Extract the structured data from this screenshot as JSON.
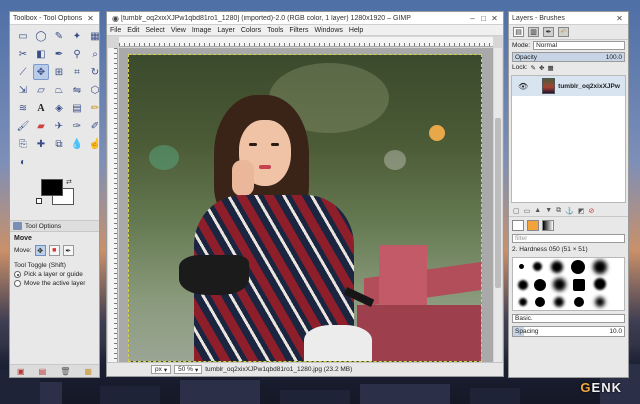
{
  "toolbox": {
    "title": "Toolbox - Tool Options",
    "tool_options_tab": "Tool Options",
    "section_title": "Move",
    "mode_label": "Move:",
    "tool_toggle_label": "Tool Toggle  (Shift)",
    "options": [
      {
        "label": "Pick a layer or guide",
        "selected": true
      },
      {
        "label": "Move the active layer",
        "selected": false
      }
    ],
    "fg_color": "#000000",
    "bg_color": "#ffffff"
  },
  "image_window": {
    "title": "[tumblr_oq2xixXJPw1qbd81ro1_1280] (imported)-2.0 (RGB color, 1 layer) 1280x1920 – GIMP",
    "menu": [
      "File",
      "Edit",
      "Select",
      "View",
      "Image",
      "Layer",
      "Colors",
      "Tools",
      "Filters",
      "Windows",
      "Help"
    ],
    "status": {
      "unit": "px",
      "zoom": "50 %",
      "file_info": "tumblr_oq2xixXJPw1qbd81ro1_1280.jpg (23.2 MB)"
    }
  },
  "layers_panel": {
    "title": "Layers - Brushes",
    "mode_label": "Mode:",
    "mode_value": "Normal",
    "opacity_label": "Opacity",
    "opacity_value": "100.0",
    "opacity_percent": 100,
    "lock_label": "Lock:",
    "layer_name": "tumblr_oq2xixXJPw",
    "filter_placeholder": "filter",
    "brush_name": "2. Hardness 050 (51 × 51)",
    "brush_tag": "Basic.",
    "spacing_label": "Spacing",
    "spacing_value": "10.0",
    "spacing_percent": 10
  },
  "watermark": {
    "prefix": "G",
    "rest": "ENK"
  }
}
